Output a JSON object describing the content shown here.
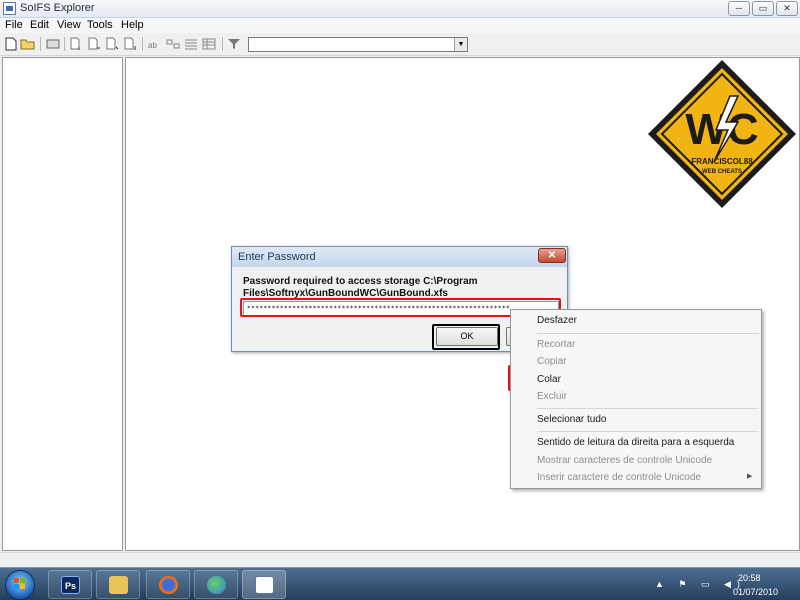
{
  "window": {
    "title": "SoIFS Explorer",
    "minimize": "─",
    "maximize": "▭",
    "close": "✕"
  },
  "menu": [
    "File",
    "Edit",
    "View",
    "Tools",
    "Help"
  ],
  "toolbar": {
    "icons": [
      "new-file-icon",
      "open-folder-icon",
      "storage-icon",
      "add-file-icon",
      "extract-icon",
      "add-folder-icon",
      "export-icon",
      "rename-icon",
      "properties-icon",
      "list-view-icon",
      "details-view-icon",
      "filter-icon"
    ],
    "filter_value": ""
  },
  "watermark": {
    "brand": "WC",
    "name": "FRANCISCOL88",
    "tagline": "WEB CHEATS"
  },
  "dialog": {
    "title": "Enter Password",
    "prompt": "Password required to access storage C:\\Program Files\\Softnyx\\GunBoundWC\\GunBound.xfs",
    "password_value": "****************************************************************",
    "ok_label": "OK"
  },
  "context_menu": [
    {
      "label": "Desfazer",
      "enabled": true
    },
    {
      "label": "Recortar",
      "enabled": false
    },
    {
      "label": "Copiar",
      "enabled": false
    },
    {
      "label": "Colar",
      "enabled": true,
      "highlighted": true
    },
    {
      "label": "Excluir",
      "enabled": false
    },
    {
      "label": "Selecionar tudo",
      "enabled": true
    },
    {
      "label": "Sentido de leitura da direita para a esquerda",
      "enabled": true
    },
    {
      "label": "Mostrar caracteres de controle Unicode",
      "enabled": false
    },
    {
      "label": "Inserir caractere de controle Unicode",
      "enabled": false,
      "submenu": true
    }
  ],
  "taskbar": {
    "apps": [
      {
        "name": "photoshop-app",
        "label": "Ps"
      },
      {
        "name": "explorer-app",
        "label": ""
      },
      {
        "name": "firefox-app",
        "label": ""
      },
      {
        "name": "messenger-app",
        "label": ""
      },
      {
        "name": "solfs-explorer-app",
        "label": ""
      }
    ],
    "time": "20:58",
    "date": "01/07/2010"
  },
  "colors": {
    "highlight_red": "#e3131a",
    "taskbar": "#2f4a6b",
    "logo_yellow": "#f2b412"
  }
}
